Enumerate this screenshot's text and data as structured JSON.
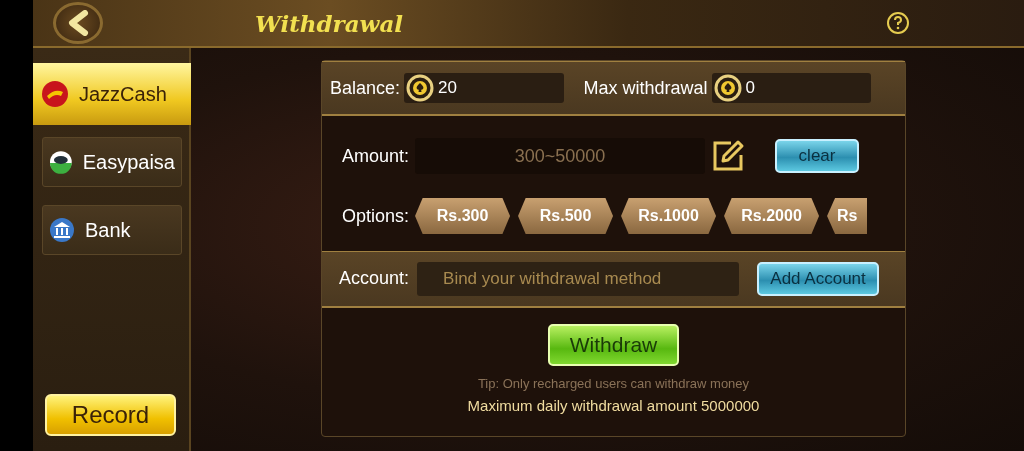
{
  "header": {
    "title": "Withdrawal"
  },
  "methods": [
    {
      "label": "JazzCash",
      "kind": "jazz",
      "selected": true
    },
    {
      "label": "Easypaisa",
      "kind": "easypaisa",
      "selected": false
    },
    {
      "label": "Bank",
      "kind": "bank",
      "selected": false
    }
  ],
  "record_button": "Record",
  "balance": {
    "label": "Balance:",
    "value": "20"
  },
  "max_withdrawal": {
    "label": "Max withdrawal",
    "value": "0"
  },
  "amount": {
    "label": "Amount:",
    "placeholder": "300~50000",
    "clear_button": "clear"
  },
  "options": {
    "label": "Options:",
    "items": [
      "Rs.300",
      "Rs.500",
      "Rs.1000",
      "Rs.2000",
      "Rs"
    ]
  },
  "account": {
    "label": "Account:",
    "placeholder": "Bind your withdrawal method",
    "add_button": "Add Account"
  },
  "withdraw_button": "Withdraw",
  "tip": "Tip: Only recharged users can withdraw money",
  "daily_limit": "Maximum daily withdrawal amount 5000000"
}
